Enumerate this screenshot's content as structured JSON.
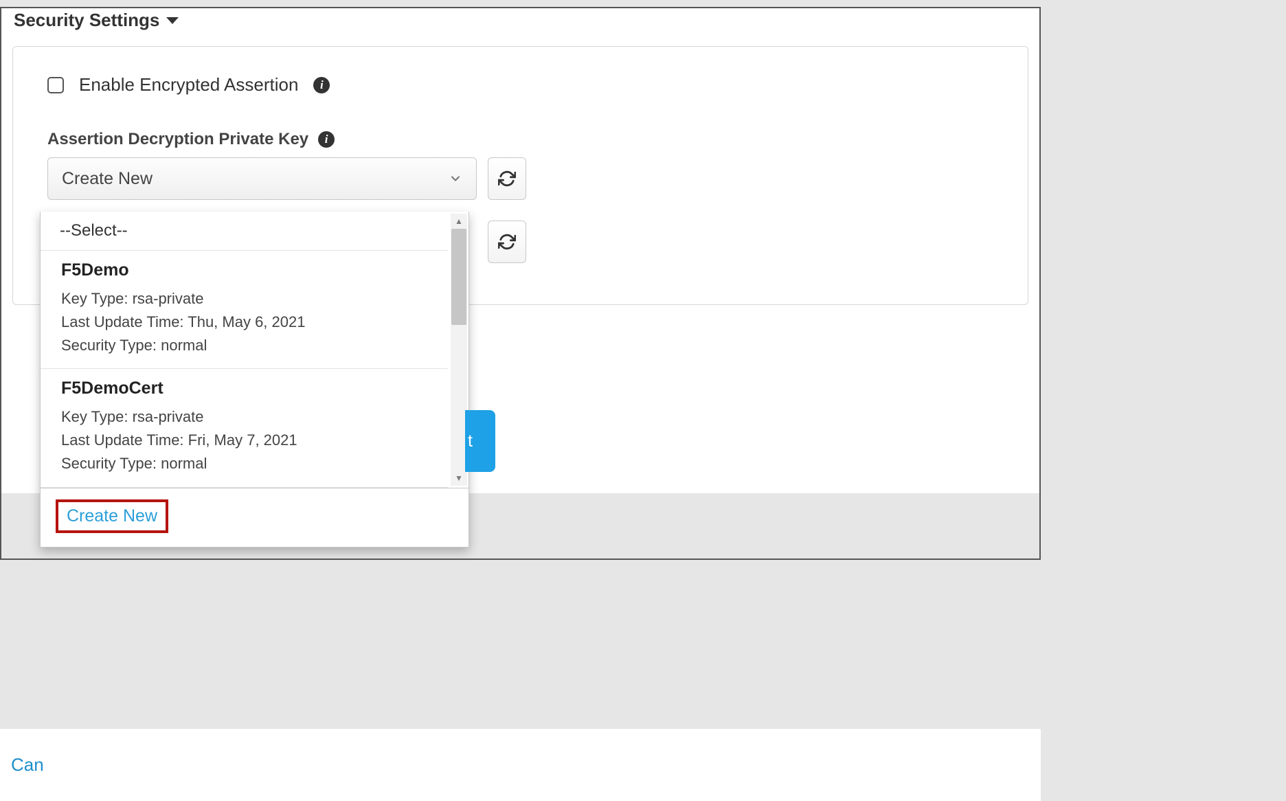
{
  "section": {
    "title": "Security Settings"
  },
  "checkbox": {
    "enable_encrypted_assertion_label": "Enable Encrypted Assertion"
  },
  "field": {
    "assertion_key_label": "Assertion Decryption Private Key",
    "selected_value": "Create New"
  },
  "dropdown": {
    "placeholder": "--Select--",
    "items": [
      {
        "name": "F5Demo",
        "key_type_label": "Key Type:",
        "key_type": "rsa-private",
        "last_update_label": "Last Update Time:",
        "last_update": "Thu, May 6, 2021",
        "security_type_label": "Security Type:",
        "security_type": "normal"
      },
      {
        "name": "F5DemoCert",
        "key_type_label": "Key Type:",
        "key_type": "rsa-private",
        "last_update_label": "Last Update Time:",
        "last_update": "Fri, May 7, 2021",
        "security_type_label": "Security Type:",
        "security_type": "normal"
      }
    ],
    "create_new": "Create New"
  },
  "footer": {
    "cancel": "Can",
    "next_fragment": "t"
  }
}
